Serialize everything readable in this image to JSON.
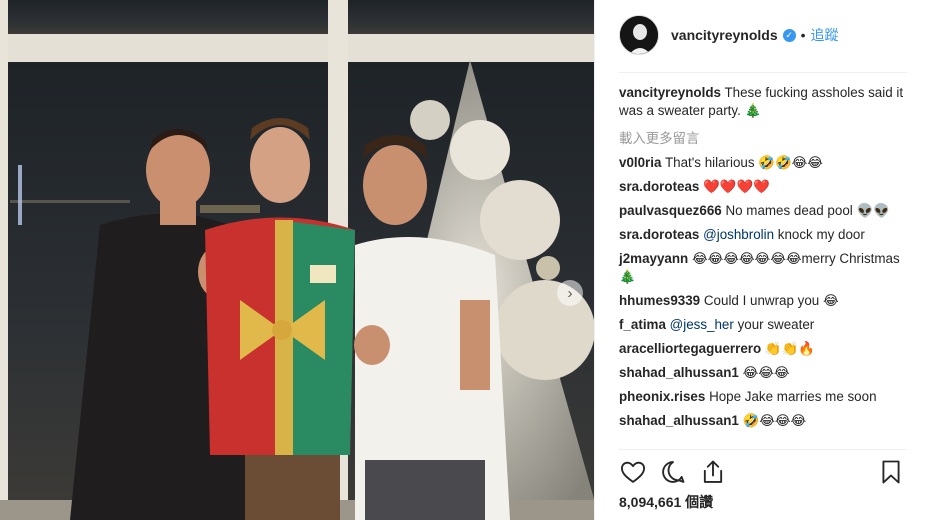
{
  "post": {
    "username": "vancityreynolds",
    "verified_glyph": "✓",
    "separator": "•",
    "follow_label": "追蹤",
    "caption": {
      "username": "vancityreynolds",
      "text": "These fucking assholes said it was a sweater party. 🎄"
    },
    "load_more_label": "載入更多留言",
    "comments": [
      {
        "username": "v0l0ria",
        "text": "That's hilarious 🤣🤣😂😂"
      },
      {
        "username": "sra.doroteas",
        "text": "❤️❤️❤️❤️"
      },
      {
        "username": "paulvasquez666",
        "text": "No mames dead pool 👽👽"
      },
      {
        "username": "sra.doroteas",
        "mention": "@joshbrolin",
        "text": " knock my door"
      },
      {
        "username": "j2mayyann",
        "text": "😂😂😂😂😂😂😂merry Christmas 🎄"
      },
      {
        "username": "hhumes9339",
        "text": "Could I unwrap you 😂"
      },
      {
        "username": "f_atima",
        "mention": "@jess_her",
        "text": " your sweater"
      },
      {
        "username": "aracelliortegaguerrero",
        "text": "👏👏🔥"
      },
      {
        "username": "shahad_alhussan1",
        "text": "😂😂😂"
      },
      {
        "username": "pheonix.rises",
        "text": "Hope Jake marries me soon"
      },
      {
        "username": "shahad_alhussan1",
        "text": "🤣😂😂😂"
      }
    ],
    "likes_label": "8,094,661 個讚",
    "icons": {
      "like": "heart-icon",
      "comment": "comment-icon",
      "share": "share-icon",
      "save": "bookmark-icon",
      "next": "chevron-right-icon"
    },
    "carousel_next_glyph": "›"
  },
  "colors": {
    "link_blue": "#3897f0",
    "mention_blue": "#003569",
    "muted_gray": "#999999",
    "text": "#262626"
  }
}
